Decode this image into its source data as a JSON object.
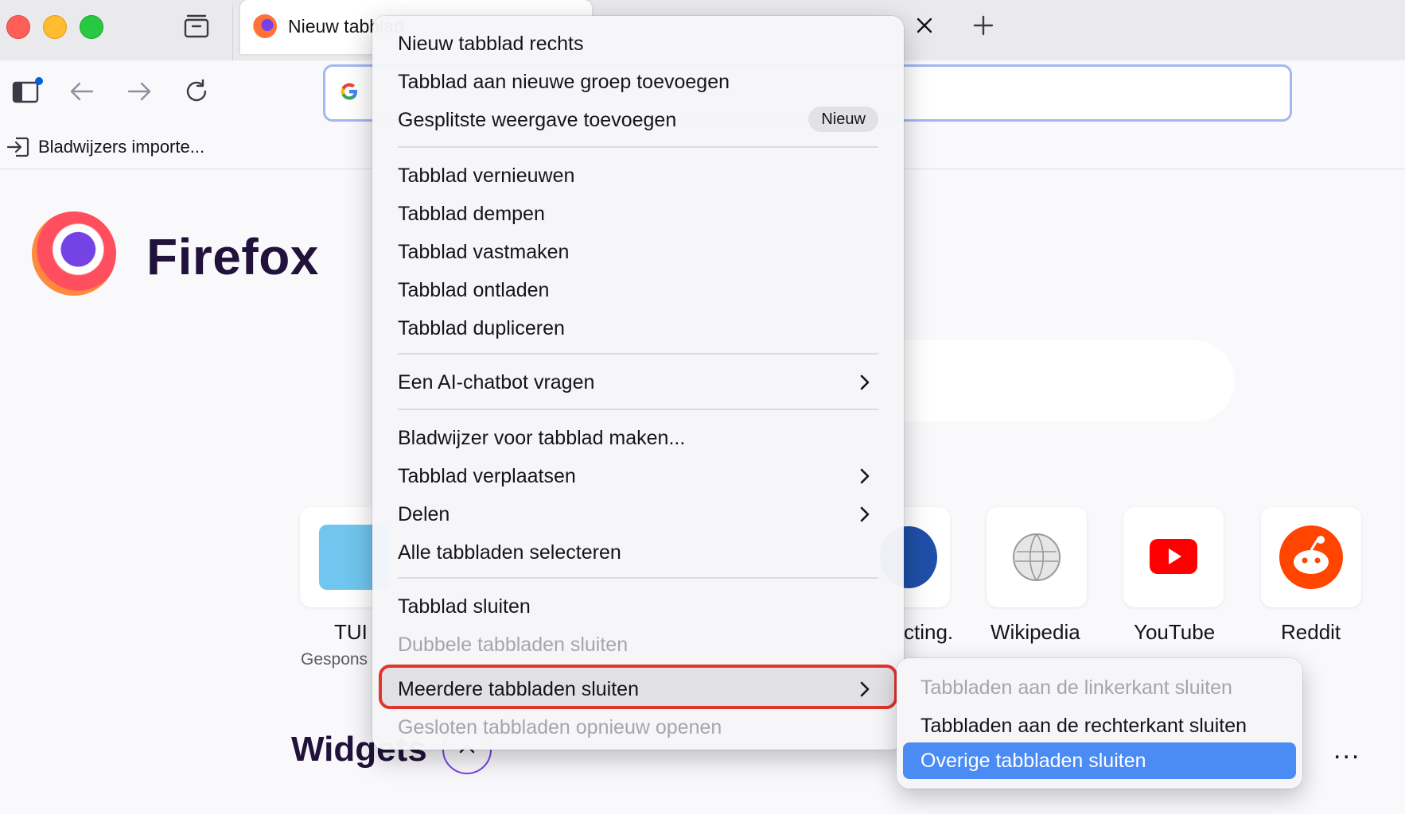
{
  "tab": {
    "title": "Nieuw tabblad"
  },
  "bookmarks_bar": {
    "import_label": "Bladwijzers importe..."
  },
  "page": {
    "brand": "Firefox",
    "shortcuts": [
      {
        "label": "TUI",
        "sub": "Gespons"
      },
      {
        "label": "cting.",
        "sub": ""
      },
      {
        "label": "Wikipedia",
        "sub": ""
      },
      {
        "label": "YouTube",
        "sub": ""
      },
      {
        "label": "Reddit",
        "sub": ""
      }
    ],
    "widgets_label": "Widgets",
    "more_label": "..."
  },
  "context_menu": {
    "items": [
      {
        "label": "Nieuw tabblad rechts",
        "enabled": true
      },
      {
        "label": "Tabblad aan nieuwe groep toevoegen",
        "enabled": true
      },
      {
        "label": "Gesplitste weergave toevoegen",
        "enabled": true,
        "badge": "Nieuw"
      },
      {
        "label": "Tabblad vernieuwen",
        "enabled": true
      },
      {
        "label": "Tabblad dempen",
        "enabled": true
      },
      {
        "label": "Tabblad vastmaken",
        "enabled": true
      },
      {
        "label": "Tabblad ontladen",
        "enabled": true
      },
      {
        "label": "Tabblad dupliceren",
        "enabled": true
      },
      {
        "label": "Een AI-chatbot vragen",
        "enabled": true,
        "submenu": true
      },
      {
        "label": "Bladwijzer voor tabblad maken...",
        "enabled": true
      },
      {
        "label": "Tabblad verplaatsen",
        "enabled": true,
        "submenu": true
      },
      {
        "label": "Delen",
        "enabled": true,
        "submenu": true
      },
      {
        "label": "Alle tabbladen selecteren",
        "enabled": true
      },
      {
        "label": "Tabblad sluiten",
        "enabled": true
      },
      {
        "label": "Dubbele tabbladen sluiten",
        "enabled": false
      },
      {
        "label": "Meerdere tabbladen sluiten",
        "enabled": true,
        "submenu": true,
        "highlighted": true
      },
      {
        "label": "Gesloten tabbladen opnieuw openen",
        "enabled": false
      }
    ]
  },
  "submenu": {
    "items": [
      {
        "label": "Tabbladen aan de linkerkant sluiten",
        "enabled": false
      },
      {
        "label": "Tabbladen aan de rechterkant sluiten",
        "enabled": true
      },
      {
        "label": "Overige tabbladen sluiten",
        "enabled": true,
        "selected": true
      }
    ]
  },
  "colors": {
    "accent": "#4a8bf4",
    "highlight_outline": "#e3332d",
    "brand_text": "#20123a"
  }
}
